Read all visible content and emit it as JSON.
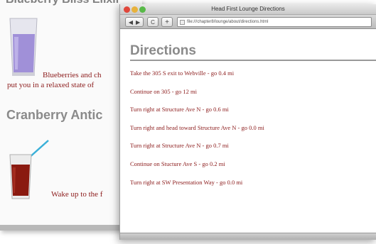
{
  "background_page": {
    "top_heading": "Blueberry Bliss Elixir",
    "blueberry_text_line1": "Blueberries and ch",
    "blueberry_text_line2": "put you in a relaxed state of",
    "cranberry_heading": "Cranberry Antic",
    "cranberry_text": "Wake up to the f",
    "colors": {
      "blueberry_drink": "#a090d8",
      "cranberry_drink": "#8a1a10",
      "text": "#8b1a1a",
      "heading": "#8a8a8a"
    }
  },
  "browser": {
    "window_title": "Head First Lounge Directions",
    "nav": {
      "back_icon": "◀",
      "forward_icon": "▶",
      "reload_icon": "C",
      "add_icon": "+"
    },
    "address": "file:///chapter8/lounge/about/directions.html",
    "page_title": "Directions",
    "steps": [
      "Take the 305 S exit to Webville - go 0.4 mi",
      "Continue on 305 - go 12 mi",
      "Turn right at Structure Ave N - go 0.6 mi",
      "Turn right and head toward Structure Ave N - go 0.0 mi",
      "Turn right at Structure Ave N - go 0.7 mi",
      "Continue on Stucture Ave S - go 0.2 mi",
      "Turn right at SW Presentation Way - go 0.0 mi"
    ],
    "colors": {
      "close": "#e0463a",
      "minimize": "#e8b23c",
      "maximize": "#58b948"
    }
  }
}
